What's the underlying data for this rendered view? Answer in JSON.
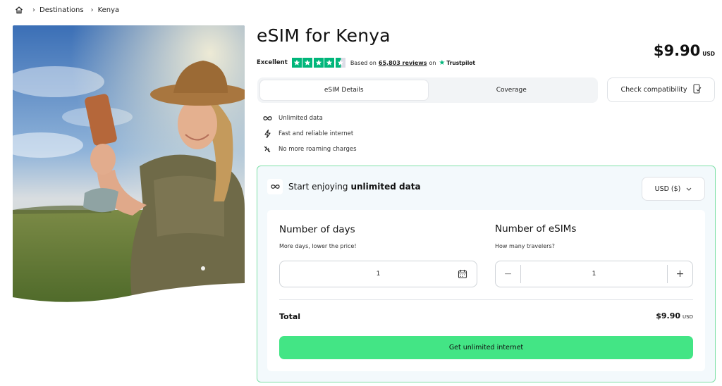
{
  "breadcrumb": {
    "home_icon": "home-icon",
    "items": [
      "Destinations",
      "Kenya"
    ]
  },
  "hero": {
    "image": "woman-taking-selfie-savanna",
    "accent": "#4a7fc0"
  },
  "product": {
    "title": "eSIM for Kenya",
    "price": "$9.90",
    "currency_code": "USD"
  },
  "rating": {
    "label": "Excellent",
    "stars": 4.5,
    "based_on": "Based on",
    "reviews": "65,803 reviews",
    "on": "on",
    "provider": "Trustpilot",
    "star_color": "#00b67a"
  },
  "tabs": [
    {
      "label": "eSIM Details",
      "active": true
    },
    {
      "label": "Coverage",
      "active": false
    }
  ],
  "compat_button": {
    "label": "Check compatibility",
    "icon": "phone-check-icon"
  },
  "features": [
    {
      "icon": "infinity-icon",
      "label": "Unlimited data"
    },
    {
      "icon": "lightning-icon",
      "label": "Fast and reliable internet"
    },
    {
      "icon": "no-roaming-icon",
      "label": "No more roaming charges"
    }
  ],
  "plan": {
    "heading_prefix": "Start enjoying",
    "heading_bold": "unlimited data",
    "currency_select": "USD ($)",
    "days": {
      "label": "Number of days",
      "sub": "More days, lower the price!",
      "value": "1"
    },
    "esims": {
      "label": "Number of eSIMs",
      "sub": "How many travelers?",
      "value": "1",
      "minus": "−",
      "plus": "+"
    },
    "total_label": "Total",
    "total_price": "$9.90",
    "total_currency": "USD",
    "cta": "Get unlimited internet",
    "border_color": "#7fe0a8",
    "cta_color": "#43e585"
  }
}
